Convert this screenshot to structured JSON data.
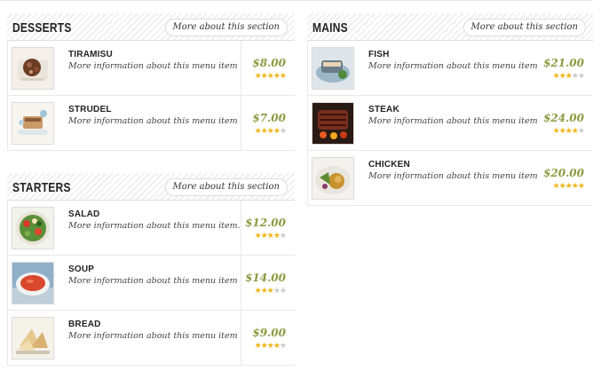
{
  "sections": {
    "desserts": {
      "title": "DESSERTS",
      "more_label": "More about this section",
      "items": [
        {
          "name": "TIRAMISU",
          "desc": "More information about this menu item",
          "price": "$8.00",
          "rating": 5,
          "image_icon": "tiramisu-photo-icon"
        },
        {
          "name": "STRUDEL",
          "desc": "More information about this menu item",
          "price": "$7.00",
          "rating": 4,
          "image_icon": "strudel-photo-icon"
        }
      ]
    },
    "starters": {
      "title": "STARTERS",
      "more_label": "More about this section",
      "items": [
        {
          "name": "SALAD",
          "desc": "More information about this menu item.",
          "price": "$12.00",
          "rating": 4,
          "image_icon": "salad-photo-icon"
        },
        {
          "name": "SOUP",
          "desc": "More information about this menu item",
          "price": "$14.00",
          "rating": 3,
          "image_icon": "soup-photo-icon"
        },
        {
          "name": "BREAD",
          "desc": "More information about this menu item",
          "price": "$9.00",
          "rating": 4,
          "image_icon": "bread-photo-icon"
        }
      ]
    },
    "mains": {
      "title": "MAINS",
      "more_label": "More about this section",
      "items": [
        {
          "name": "FISH",
          "desc": "More information about this menu item",
          "price": "$21.00",
          "rating": 3,
          "image_icon": "fish-photo-icon"
        },
        {
          "name": "STEAK",
          "desc": "More information about this menu item",
          "price": "$24.00",
          "rating": 4,
          "image_icon": "steak-photo-icon"
        },
        {
          "name": "CHICKEN",
          "desc": "More information about this menu item",
          "price": "$20.00",
          "rating": 5,
          "image_icon": "chicken-photo-icon"
        }
      ]
    }
  },
  "rating_max": 5,
  "colors": {
    "price": "#8c9a3f",
    "star_on": "#f0b516",
    "star_off": "#c9c9c9"
  }
}
